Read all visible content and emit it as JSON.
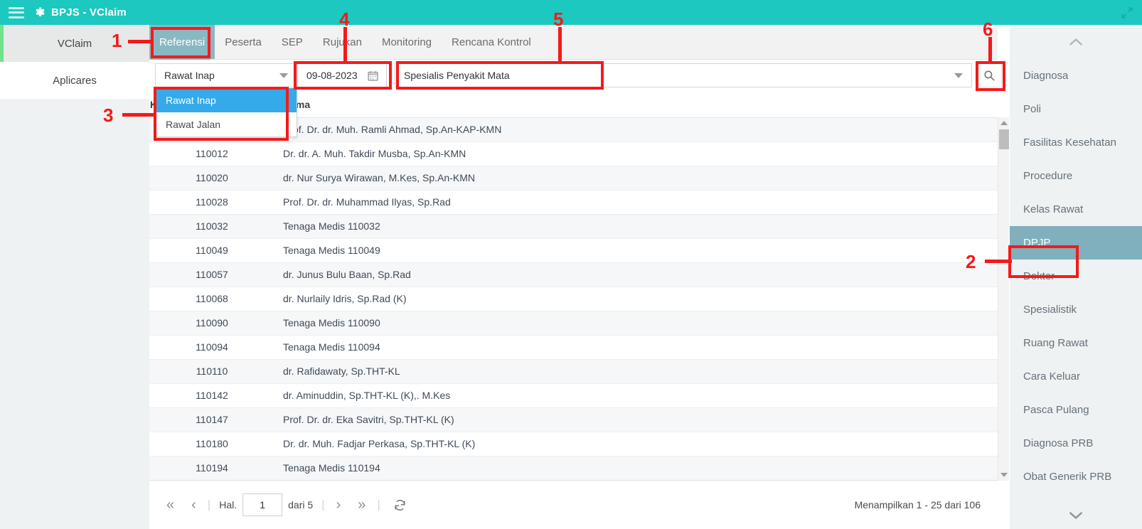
{
  "window": {
    "title": "BPJS - VClaim",
    "menu_icon": "hamburger-icon",
    "brand_icon": "gear-icon",
    "expand_icon": "expand-icon",
    "accent_teal": "#1cc8bf"
  },
  "left_rail": {
    "items": [
      {
        "label": "VClaim",
        "active": true
      },
      {
        "label": "Aplicares",
        "active": false
      }
    ],
    "accent_green": "#6fe28a"
  },
  "tabs": [
    {
      "label": "Referensi",
      "active": true
    },
    {
      "label": "Peserta",
      "active": false
    },
    {
      "label": "SEP",
      "active": false
    },
    {
      "label": "Rujukan",
      "active": false
    },
    {
      "label": "Monitoring",
      "active": false
    },
    {
      "label": "Rencana Kontrol",
      "active": false
    }
  ],
  "tab_active_color": "#8ab8c2",
  "filters": {
    "jenis_pelayanan": {
      "value": "Rawat Inap",
      "options": [
        {
          "label": "Rawat Inap",
          "selected": true
        },
        {
          "label": "Rawat Jalan",
          "selected": false
        }
      ]
    },
    "tanggal": {
      "value": "09-08-2023",
      "icon": "calendar-icon"
    },
    "spesialistik": {
      "value": "Spesialis Penyakit Mata"
    },
    "search_button": {
      "icon": "search-icon"
    }
  },
  "table": {
    "columns": [
      "Kode",
      "Nama"
    ],
    "rows": [
      {
        "kode": "",
        "nama": "Prof. Dr. dr. Muh. Ramli Ahmad, Sp.An-KAP-KMN"
      },
      {
        "kode": "110012",
        "nama": "Dr. dr. A. Muh. Takdir Musba, Sp.An-KMN"
      },
      {
        "kode": "110020",
        "nama": "dr. Nur Surya Wirawan, M.Kes, Sp.An-KMN"
      },
      {
        "kode": "110028",
        "nama": "Prof. Dr. dr. Muhammad Ilyas, Sp.Rad"
      },
      {
        "kode": "110032",
        "nama": "Tenaga Medis 110032"
      },
      {
        "kode": "110049",
        "nama": "Tenaga Medis 110049"
      },
      {
        "kode": "110057",
        "nama": "dr. Junus Bulu Baan, Sp.Rad"
      },
      {
        "kode": "110068",
        "nama": "dr. Nurlaily Idris, Sp.Rad (K)"
      },
      {
        "kode": "110090",
        "nama": "Tenaga Medis 110090"
      },
      {
        "kode": "110094",
        "nama": "Tenaga Medis 110094"
      },
      {
        "kode": "110110",
        "nama": "dr. Rafidawaty, Sp.THT-KL"
      },
      {
        "kode": "110142",
        "nama": "dr. Aminuddin, Sp.THT-KL (K),. M.Kes"
      },
      {
        "kode": "110147",
        "nama": "Prof. Dr. dr. Eka Savitri, Sp.THT-KL (K)"
      },
      {
        "kode": "110180",
        "nama": "Dr. dr. Muh. Fadjar Perkasa, Sp.THT-KL (K)"
      },
      {
        "kode": "110194",
        "nama": "Tenaga Medis 110194"
      }
    ]
  },
  "pagination": {
    "first_icon": "«",
    "prev_icon": "‹",
    "page_label": "Hal.",
    "page_value": "1",
    "of_label": "dari 5",
    "next_icon": "›",
    "last_icon": "»",
    "refresh_icon": "refresh-icon",
    "info": "Menampilkan 1 - 25 dari 106"
  },
  "right_menu": {
    "collapse_up_icon": "chevron-up-icon",
    "collapse_down_icon": "chevron-down-icon",
    "active_color": "#7fb0bc",
    "items": [
      {
        "label": "Diagnosa",
        "active": false
      },
      {
        "label": "Poli",
        "active": false
      },
      {
        "label": "Fasilitas Kesehatan",
        "active": false
      },
      {
        "label": "Procedure",
        "active": false
      },
      {
        "label": "Kelas Rawat",
        "active": false
      },
      {
        "label": "DPJP",
        "active": true
      },
      {
        "label": "Dokter",
        "active": false
      },
      {
        "label": "Spesialistik",
        "active": false
      },
      {
        "label": "Ruang Rawat",
        "active": false
      },
      {
        "label": "Cara Keluar",
        "active": false
      },
      {
        "label": "Pasca Pulang",
        "active": false
      },
      {
        "label": "Diagnosa PRB",
        "active": false
      },
      {
        "label": "Obat Generik PRB",
        "active": false
      }
    ]
  },
  "annotations": {
    "color": "#f41a1a",
    "markers": [
      {
        "number": "1",
        "target": "tab-referensi"
      },
      {
        "number": "2",
        "target": "right-menu-item-dpjp"
      },
      {
        "number": "3",
        "target": "jenis-pelayanan-dropdown-list"
      },
      {
        "number": "4",
        "target": "tanggal-field"
      },
      {
        "number": "5",
        "target": "spesialistik-field"
      },
      {
        "number": "6",
        "target": "search-button"
      }
    ]
  }
}
